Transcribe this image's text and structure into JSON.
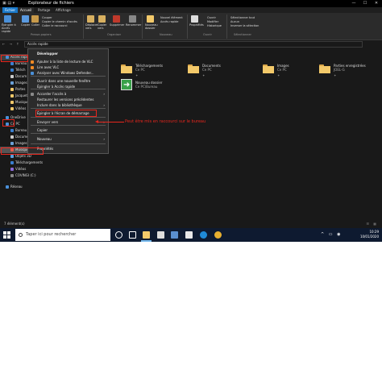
{
  "window": {
    "title": "Explorateur de fichiers",
    "controls": [
      "—",
      "☐",
      "✕"
    ]
  },
  "tabs": [
    "Fichier",
    "Accueil",
    "Partage",
    "Affichage"
  ],
  "ribbon": {
    "pin_label": "Épingler à Accès rapide",
    "copy_label": "Copier",
    "paste_label": "Coller",
    "cut_label": "Couper",
    "copy_path_label": "Copier le chemin d'accès",
    "paste_shortcut_label": "Coller le raccourci",
    "move_to_label": "Déplacer vers",
    "copy_to_label": "Copier vers",
    "delete_label": "Supprimer",
    "rename_label": "Renommer",
    "new_folder_label": "Nouveau dossier",
    "new_item_label": "Nouvel élément",
    "easy_access_label": "Accès rapide",
    "properties_label": "Propriétés",
    "open_label": "Ouvrir",
    "edit_label": "Modifier",
    "history_label": "Historique",
    "select_all_label": "Sélectionner tout",
    "select_none_label": "Aucun",
    "invert_label": "Inverser la sélection",
    "groups": [
      "Presse-papiers",
      "Organiser",
      "Nouveau",
      "Ouvrir",
      "Sélectionner"
    ]
  },
  "address": {
    "path": "Accès rapide",
    "nav": "← → ↑"
  },
  "nav_pane": {
    "items": [
      {
        "label": "Accès rapide",
        "color": "#4a90d9"
      },
      {
        "label": "Bureau",
        "color": "#3a7fd0"
      },
      {
        "label": "Téléch",
        "color": "#3a7fd0"
      },
      {
        "label": "Docum",
        "color": "#cccccc"
      },
      {
        "label": "Images",
        "color": "#6aa0d8"
      },
      {
        "label": "Partes",
        "color": "#f3c96a"
      },
      {
        "label": "Jacquette",
        "color": "#f3c96a"
      },
      {
        "label": "Musique",
        "color": "#f3c96a"
      },
      {
        "label": "Vidéos",
        "color": "#f3c96a"
      },
      {
        "label": "OneDrive",
        "color": "#4a90d9"
      },
      {
        "label": "Ce PC",
        "color": "#4a90d9"
      },
      {
        "label": "Bureau",
        "color": "#3a7fd0"
      },
      {
        "label": "Docume",
        "color": "#cccccc"
      },
      {
        "label": "Images",
        "color": "#6aa0d8"
      },
      {
        "label": "Musique",
        "color": "#e85a4a"
      },
      {
        "label": "Objets 3D",
        "color": "#5aa0e0"
      },
      {
        "label": "Téléchargements",
        "color": "#3a7fd0"
      },
      {
        "label": "Vidéos",
        "color": "#8a6ad8"
      },
      {
        "label": "COVINGI (C:)",
        "color": "#888888"
      },
      {
        "label": "Réseau",
        "color": "#4a90d9"
      }
    ]
  },
  "files": [
    {
      "name": "Téléchargements",
      "loc": "Ce PC",
      "kind": "folder"
    },
    {
      "name": "Documents",
      "loc": "Ce PC",
      "kind": "folder"
    },
    {
      "name": "Images",
      "loc": "Ce PC",
      "kind": "folder"
    },
    {
      "name": "Parties enregistrées",
      "loc": "JOEL-G",
      "kind": "folder"
    },
    {
      "name": "Nouveau dossier",
      "loc": "Ce PC\\Bureau",
      "kind": "shortcut"
    }
  ],
  "context_menu": {
    "items": [
      "Développer",
      "Ajouter à la liste de lecture de VLC",
      "Lire avec VLC",
      "Analyser avec Windows Defender...",
      "Ouvrir dans une nouvelle fenêtre",
      "Épingler à Accès rapide",
      "Accorder l'accès à",
      "Restaurer les versions précédentes",
      "Inclure dans la bibliothèque",
      "Épingler à l'écran de démarrage",
      "Envoyer vers",
      "Copier",
      "Nouveau",
      "Propriétés"
    ]
  },
  "annotation": {
    "text": "Peut être mis en raccourci sur le bureau"
  },
  "status": {
    "count": "7 élément(s)",
    "views": "☰ ▦"
  },
  "taskbar": {
    "search_placeholder": "Taper ici pour rechercher",
    "time": "10:29",
    "date": "10/01/2020",
    "tray_icons": "^ ▭ ◉",
    "lang": "FRA"
  }
}
